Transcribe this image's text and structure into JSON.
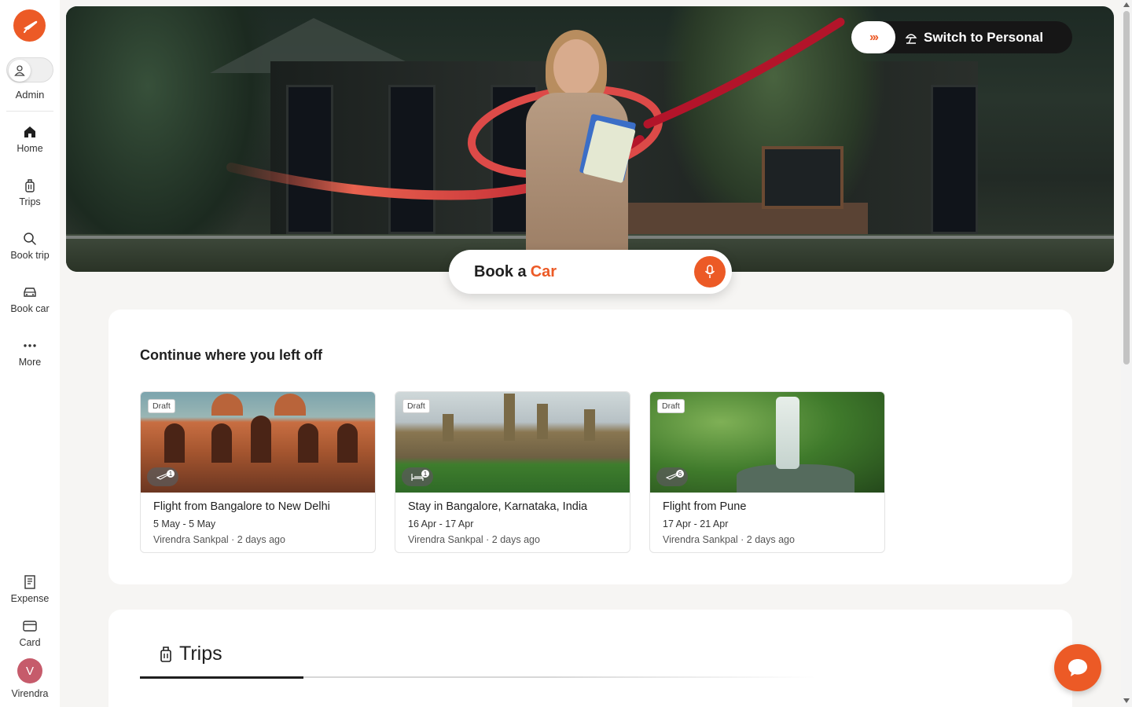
{
  "sidebar": {
    "role_label": "Admin",
    "items": [
      {
        "label": "Home",
        "icon": "home-icon"
      },
      {
        "label": "Trips",
        "icon": "suitcase-icon"
      },
      {
        "label": "Book trip",
        "icon": "search-icon"
      },
      {
        "label": "Book car",
        "icon": "car-icon"
      },
      {
        "label": "More",
        "icon": "more-dots-icon"
      }
    ],
    "bottom_items": [
      {
        "label": "Expense",
        "icon": "receipt-icon"
      },
      {
        "label": "Card",
        "icon": "card-icon"
      }
    ],
    "user": {
      "initial": "V",
      "name": "Virendra"
    }
  },
  "hero": {
    "switch_label": "Switch to Personal",
    "switch_arrows": "›››",
    "booker_prefix": "Book a",
    "booker_highlight": "Car"
  },
  "continue": {
    "title": "Continue where you left off",
    "cards": [
      {
        "badge": "Draft",
        "type": "flight",
        "count": "1",
        "title": "Flight from Bangalore to New Delhi",
        "dates": "5 May - 5 May",
        "meta": "Virendra Sankpal · 2 days ago"
      },
      {
        "badge": "Draft",
        "type": "hotel",
        "count": "1",
        "title": "Stay in Bangalore, Karnataka, India",
        "dates": "16 Apr - 17 Apr",
        "meta": "Virendra Sankpal · 2 days ago"
      },
      {
        "badge": "Draft",
        "type": "flight",
        "count": "6",
        "title": "Flight from Pune",
        "dates": "17 Apr - 21 Apr",
        "meta": "Virendra Sankpal · 2 days ago"
      }
    ]
  },
  "trips": {
    "tab_label": "Trips"
  },
  "colors": {
    "accent": "#ec5a26",
    "avatar": "#c65b6b",
    "dark": "#161616"
  }
}
